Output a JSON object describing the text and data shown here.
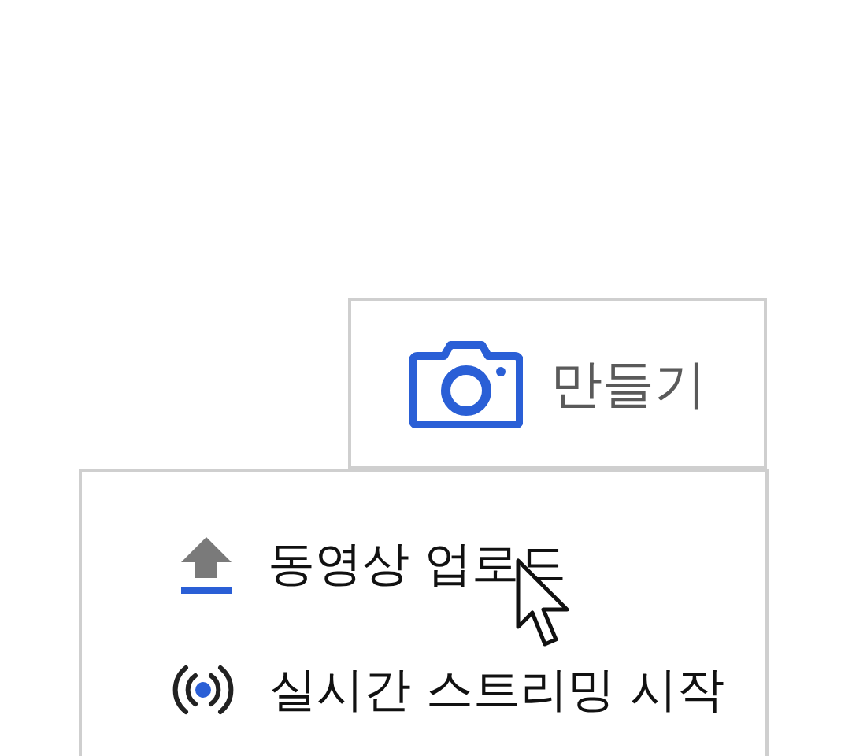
{
  "create_button": {
    "label": "만들기"
  },
  "menu": {
    "items": [
      {
        "kind": "upload",
        "label": "동영상 업로드",
        "hovered": true
      },
      {
        "kind": "live",
        "label": "실시간 스트리밍 시작",
        "hovered": false
      }
    ]
  }
}
